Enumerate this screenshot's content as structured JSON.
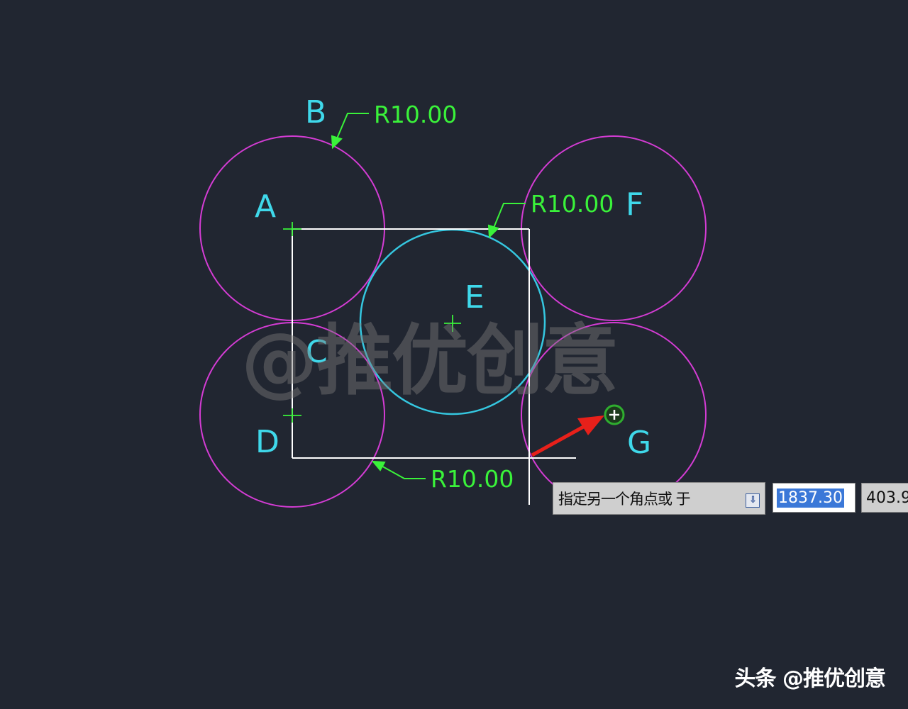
{
  "drawing": {
    "points": {
      "A": "A",
      "B": "B",
      "C": "C",
      "D": "D",
      "E": "E",
      "F": "F",
      "G": "G"
    },
    "dimensions": {
      "top_left": "R10.00",
      "top_right": "R10.00",
      "bottom": "R10.00"
    },
    "colors": {
      "background": "#212631",
      "circle_outer": "#d43cd4",
      "circle_center": "#35c7e0",
      "rectangle": "#ffffff",
      "labels": "#3fd8ea",
      "dimensions": "#3af23a",
      "arrow": "#e8201a"
    }
  },
  "watermark": "@推优创意",
  "command_prompt": {
    "text": "指定另一个角点或 于",
    "icon": "dropdown-icon"
  },
  "coordinates": {
    "x_value": "1837.30",
    "y_value": "403.9"
  },
  "footer_credit": "头条 @推优创意"
}
